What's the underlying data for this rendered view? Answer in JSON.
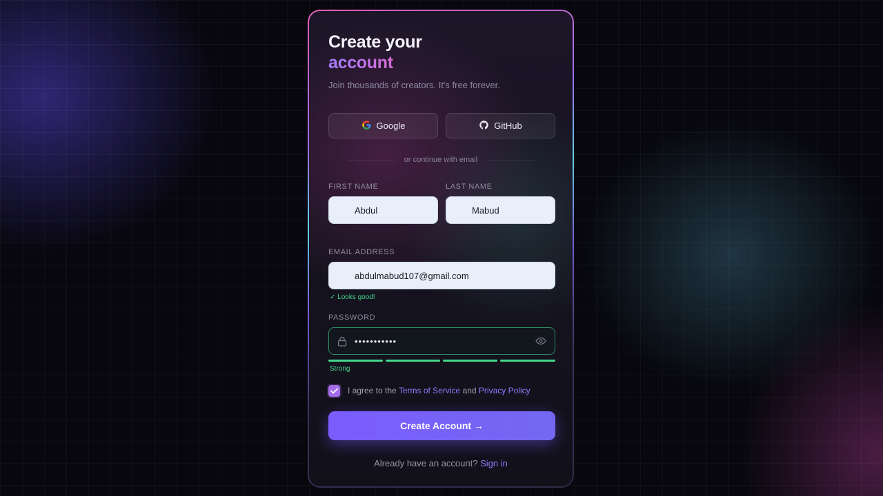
{
  "form": {
    "title_line1": "Create your",
    "title_line2": "account",
    "subtitle": "Join thousands of creators. It's free forever."
  },
  "social": {
    "google_label": "Google",
    "github_label": "GitHub"
  },
  "divider_text": "or continue with email",
  "fields": {
    "first_name_label": "FIRST NAME",
    "first_name_value": "Abdul",
    "last_name_label": "LAST NAME",
    "last_name_value": "Mabud",
    "email_label": "EMAIL ADDRESS",
    "email_value": "abdulmabud107@gmail.com",
    "email_hint": "✓ Looks good!",
    "password_label": "PASSWORD",
    "password_value": "•••••••••••",
    "strength_label": "Strong",
    "strength_segments_filled": 4
  },
  "terms": {
    "prefix": "I agree to the",
    "terms_link": "Terms of Service",
    "and": "and",
    "privacy_link": "Privacy Policy",
    "checked": true
  },
  "cta_label": "Create Account →",
  "signin": {
    "prompt": "Already have an account?",
    "link": "Sign in"
  },
  "colors": {
    "accent": "#7b5cff",
    "success": "#45d98b",
    "link": "#8e7cff"
  }
}
